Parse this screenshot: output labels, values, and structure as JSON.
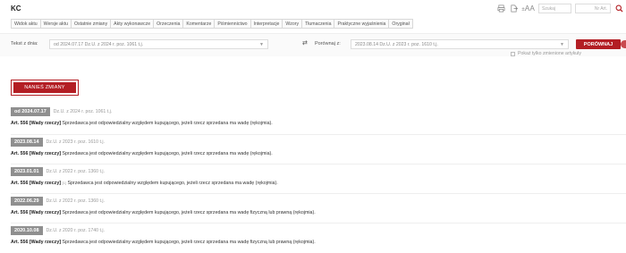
{
  "header": {
    "title": "KC",
    "font_size_label": "AA",
    "search_placeholder": "Szukaj",
    "art_placeholder": "Nr Art."
  },
  "tabs": [
    "Widok aktu",
    "Wersje aktu",
    "Ostatnie zmiany",
    "Akty wykonawcze",
    "Orzeczenia",
    "Komentarze",
    "Piśmiennictwo",
    "Interpretacje",
    "Wzory",
    "Tłumaczenia",
    "Praktyczne wyjaśnienia",
    "Oryginał"
  ],
  "compare": {
    "from_label": "Tekst z dnia:",
    "from_value": "od 2024.07.17 Dz.U. z 2024 r. poz. 1061 t.j.",
    "to_label": "Porównaj z:",
    "to_value": "2023.08.14 Dz.U. z 2023 r. poz. 1610 t.j.",
    "compare_button": "PORÓWNAJ",
    "show_changed_only": "Pokaż tylko zmienione artykuły"
  },
  "apply_button": "NANIEŚ ZMIANY",
  "entries": [
    {
      "date": "od 2024.07.17",
      "source": "Dz.U. z 2024 r. poz. 1061 t.j.",
      "label": "Art. 556 [Wady rzeczy]",
      "footnote": "",
      "text": "Sprzedawca jest odpowiedzialny względem kupującego, jeżeli rzecz sprzedana ma wadę (rękojmia)."
    },
    {
      "date": "2023.08.14",
      "source": "Dz.U. z 2023 r. poz. 1610 t.j.",
      "label": "Art. 556 [Wady rzeczy]",
      "footnote": "",
      "text": "Sprzedawca jest odpowiedzialny względem kupującego, jeżeli rzecz sprzedana ma wadę (rękojmia)."
    },
    {
      "date": "2023.01.01",
      "source": "Dz.U. z 2022 r. poz. 1360 t.j.",
      "label": "Art. 556 [Wady rzeczy]",
      "footnote": "[1]",
      "text": "Sprzedawca jest odpowiedzialny względem kupującego, jeżeli rzecz sprzedana ma wadę (rękojmia)."
    },
    {
      "date": "2022.06.29",
      "source": "Dz.U. z 2022 r. poz. 1360 t.j.",
      "label": "Art. 556 [Wady rzeczy]",
      "footnote": "",
      "text": "Sprzedawca jest odpowiedzialny względem kupującego, jeżeli rzecz sprzedana ma wadę fizyczną lub prawną (rękojmia)."
    },
    {
      "date": "2020.10.08",
      "source": "Dz.U. z 2020 r. poz. 1740 t.j.",
      "label": "Art. 556 [Wady rzeczy]",
      "footnote": "",
      "text": "Sprzedawca jest odpowiedzialny względem kupującego, jeżeli rzecz sprzedana ma wadę fizyczną lub prawną (rękojmia)."
    }
  ],
  "colors": {
    "accent": "#b31e24",
    "badge": "#8f8f8f"
  }
}
